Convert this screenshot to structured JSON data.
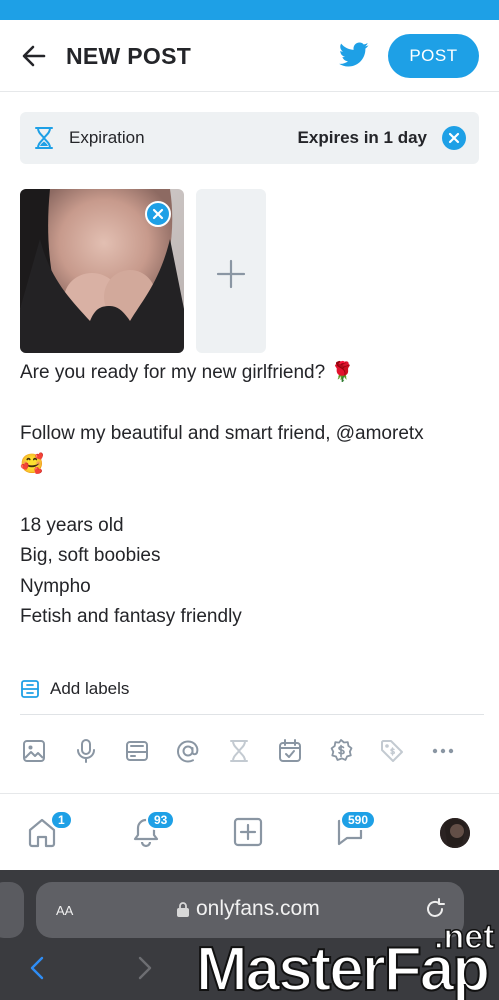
{
  "header": {
    "title": "NEW POST",
    "post_label": "POST"
  },
  "expiration": {
    "label": "Expiration",
    "value": "Expires in 1 day"
  },
  "post_text": [
    "Are you ready for my new girlfriend? 🌹",
    "",
    "Follow my beautiful and smart friend, @amoretx",
    "🥰",
    "",
    "18 years old",
    "Big, soft boobies",
    "Nympho",
    "Fetish and fantasy friendly"
  ],
  "labels": {
    "add_label": "Add labels"
  },
  "toolbar_icons": [
    "image-icon",
    "microphone-icon",
    "vault-icon",
    "at-sign-icon",
    "hourglass-icon",
    "calendar-check-icon",
    "dollar-badge-icon",
    "price-tag-icon",
    "more-icon"
  ],
  "nav": {
    "home_badge": "1",
    "notifications_badge": "93",
    "messages_badge": "590"
  },
  "browser": {
    "text_size_label": "AA",
    "url": "onlyfans.com"
  },
  "watermark": {
    "brand": "MasterFap",
    "tld": ".net"
  },
  "colors": {
    "accent": "#1ea0e6",
    "text": "#242529",
    "muted_icon": "#8a96a3",
    "panel_bg": "#eef1f3"
  }
}
